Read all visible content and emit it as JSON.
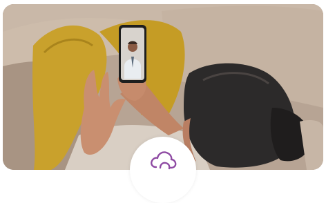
{
  "hero": {
    "image_name": "woman-on-couch-video-call-photo",
    "phone_screen": "doctor-video-call"
  },
  "badge": {
    "icon": "cloud-icon",
    "accent_color": "#8e4aa3"
  },
  "colors": {
    "background": "#ffffff",
    "couch": "#b8a593",
    "blanket": "#c9a12c",
    "hair": "#2c2a2a"
  }
}
